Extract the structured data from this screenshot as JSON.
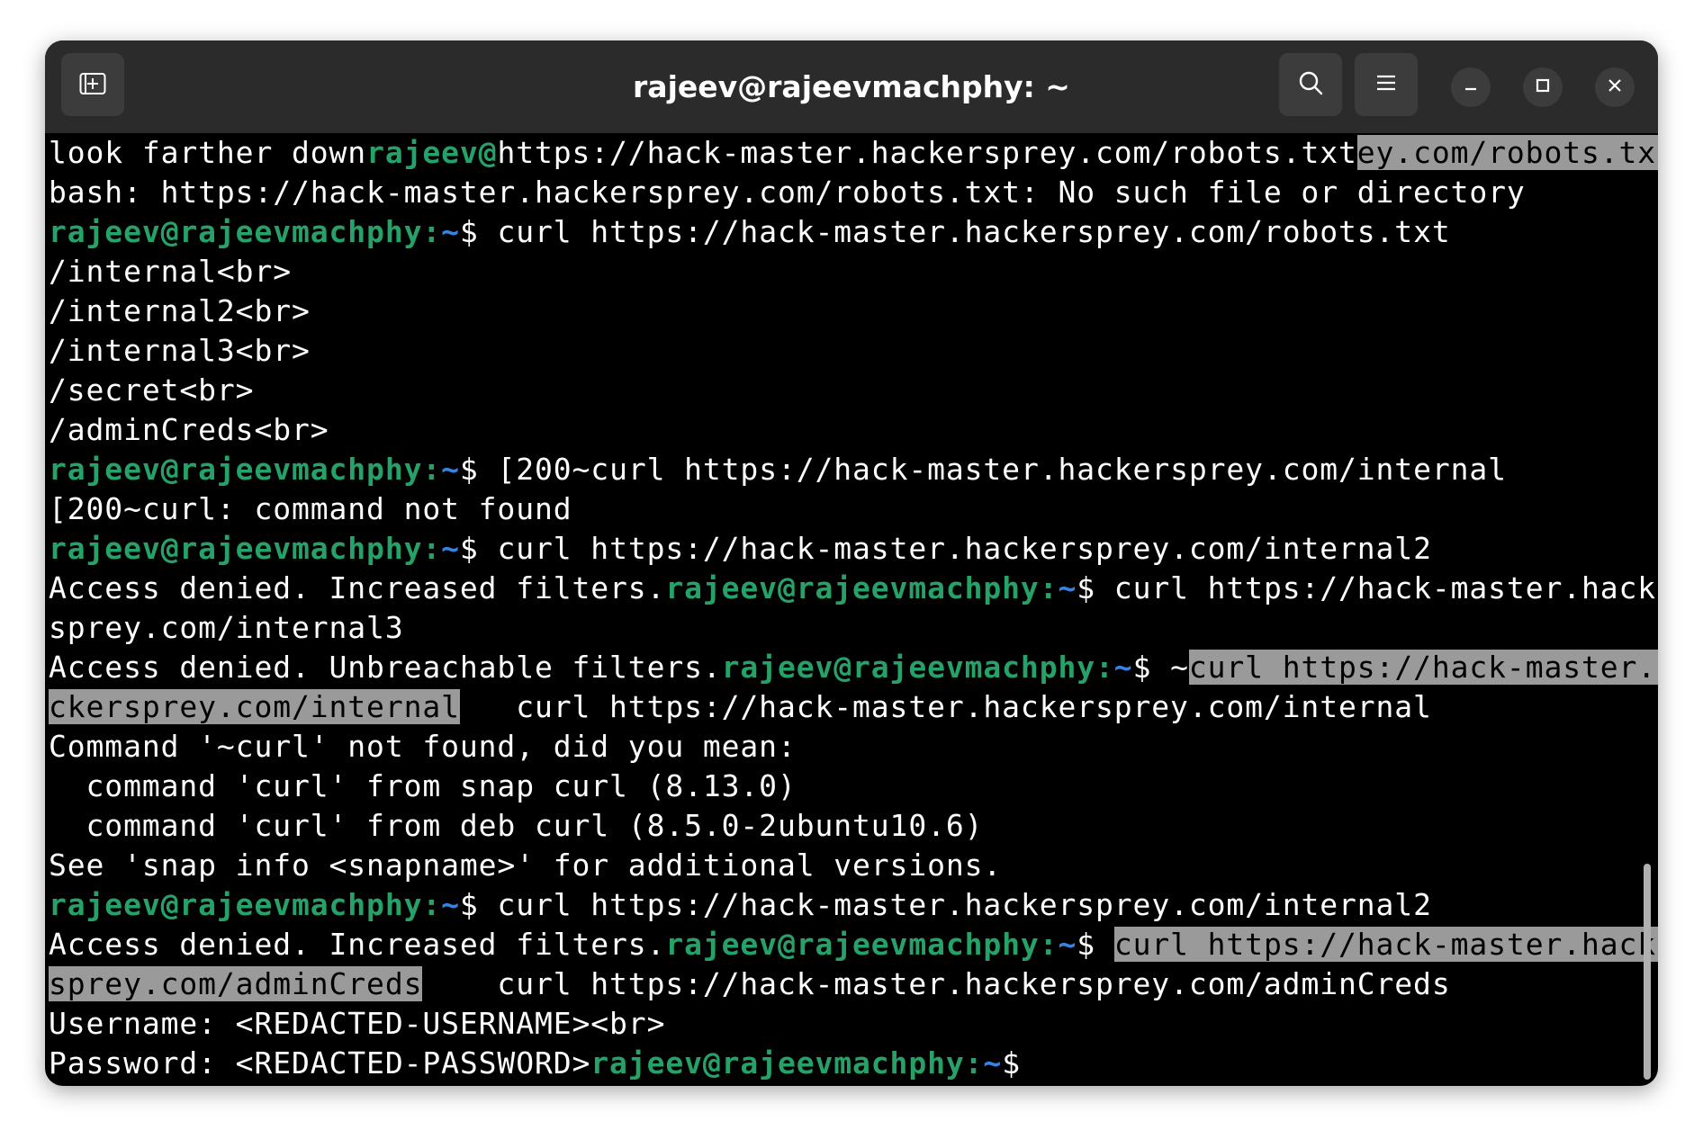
{
  "window": {
    "title": "rajeev@rajeevmachphy: ~"
  },
  "titlebar": {
    "new_tab_icon": "new-tab-icon",
    "search_icon": "search-icon",
    "menu_icon": "hamburger-menu-icon",
    "minimize_icon": "minimize-icon",
    "maximize_icon": "maximize-icon",
    "close_icon": "close-icon"
  },
  "colors": {
    "prompt_user": "#26a269",
    "prompt_path": "#3584e4",
    "selection": "#9a9a9a",
    "background": "#000000",
    "titlebar": "#2b2b2b"
  },
  "terminal": {
    "lines": [
      [
        {
          "t": "look farther down"
        },
        {
          "t": "rajeev@",
          "c": "user"
        },
        {
          "t": "https://hack-master.hackersprey.com/robots.txt"
        },
        {
          "t": "ey.com/robots.txt",
          "c": "sel"
        }
      ],
      [
        {
          "t": "bash: https://hack-master.hackersprey.com/robots.txt: No such file or directory"
        }
      ],
      [
        {
          "t": "rajeev@rajeevmachphy",
          "c": "user"
        },
        {
          "t": ":",
          "c": "user"
        },
        {
          "t": "~",
          "c": "path"
        },
        {
          "t": "$ curl https://hack-master.hackersprey.com/robots.txt"
        }
      ],
      [
        {
          "t": "/internal<br>"
        }
      ],
      [
        {
          "t": "/internal2<br>"
        }
      ],
      [
        {
          "t": "/internal3<br>"
        }
      ],
      [
        {
          "t": "/secret<br>"
        }
      ],
      [
        {
          "t": "/adminCreds<br>"
        }
      ],
      [
        {
          "t": "rajeev@rajeevmachphy",
          "c": "user"
        },
        {
          "t": ":",
          "c": "user"
        },
        {
          "t": "~",
          "c": "path"
        },
        {
          "t": "$ [200~curl https://hack-master.hackersprey.com/internal"
        }
      ],
      [
        {
          "t": "[200~curl: command not found"
        }
      ],
      [
        {
          "t": "rajeev@rajeevmachphy",
          "c": "user"
        },
        {
          "t": ":",
          "c": "user"
        },
        {
          "t": "~",
          "c": "path"
        },
        {
          "t": "$ curl https://hack-master.hackersprey.com/internal2"
        }
      ],
      [
        {
          "t": "Access denied. Increased filters."
        },
        {
          "t": "rajeev@rajeevmachphy",
          "c": "user"
        },
        {
          "t": ":",
          "c": "user"
        },
        {
          "t": "~",
          "c": "path"
        },
        {
          "t": "$ curl https://hack-master.hacker"
        }
      ],
      [
        {
          "t": "sprey.com/internal3"
        }
      ],
      [
        {
          "t": "Access denied. Unbreachable filters."
        },
        {
          "t": "rajeev@rajeevmachphy",
          "c": "user"
        },
        {
          "t": ":",
          "c": "user"
        },
        {
          "t": "~",
          "c": "path"
        },
        {
          "t": "$ ~"
        },
        {
          "t": "curl https://hack-master.ha",
          "c": "sel"
        }
      ],
      [
        {
          "t": "ckersprey.com/internal",
          "c": "sel"
        },
        {
          "t": "   curl https://hack-master.hackersprey.com/internal"
        }
      ],
      [
        {
          "t": "Command '~curl' not found, did you mean:"
        }
      ],
      [
        {
          "t": "  command 'curl' from snap curl (8.13.0)"
        }
      ],
      [
        {
          "t": "  command 'curl' from deb curl (8.5.0-2ubuntu10.6)"
        }
      ],
      [
        {
          "t": "See 'snap info <snapname>' for additional versions."
        }
      ],
      [
        {
          "t": "rajeev@rajeevmachphy",
          "c": "user"
        },
        {
          "t": ":",
          "c": "user"
        },
        {
          "t": "~",
          "c": "path"
        },
        {
          "t": "$ curl https://hack-master.hackersprey.com/internal2"
        }
      ],
      [
        {
          "t": "Access denied. Increased filters."
        },
        {
          "t": "rajeev@rajeevmachphy",
          "c": "user"
        },
        {
          "t": ":",
          "c": "user"
        },
        {
          "t": "~",
          "c": "path"
        },
        {
          "t": "$ "
        },
        {
          "t": "curl https://hack-master.hacker",
          "c": "sel"
        }
      ],
      [
        {
          "t": "sprey.com/adminCreds",
          "c": "sel"
        },
        {
          "t": "    curl https://hack-master.hackersprey.com/adminCreds"
        }
      ],
      [
        {
          "t": "Username: <REDACTED-USERNAME><br>"
        }
      ],
      [
        {
          "t": "Password: <REDACTED-PASSWORD>"
        },
        {
          "t": "rajeev@rajeevmachphy",
          "c": "user"
        },
        {
          "t": ":",
          "c": "user"
        },
        {
          "t": "~",
          "c": "path"
        },
        {
          "t": "$"
        }
      ]
    ]
  }
}
